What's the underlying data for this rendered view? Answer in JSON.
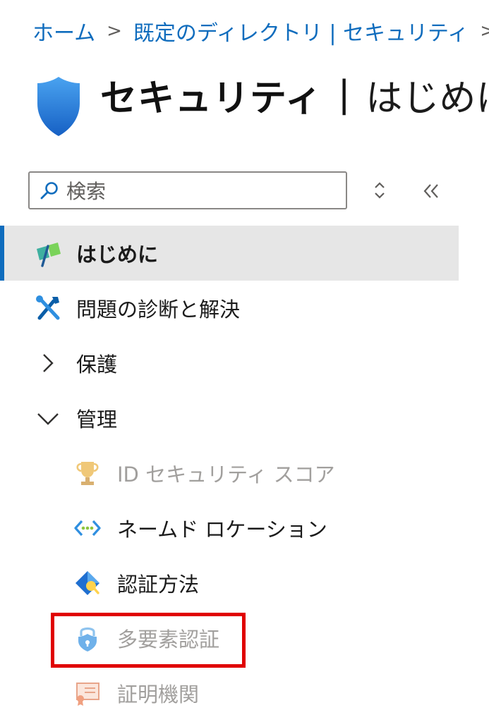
{
  "breadcrumb": {
    "items": [
      "ホーム",
      "既定のディレクトリ | セキュリティ"
    ],
    "separator": ">"
  },
  "header": {
    "title": "セキュリティ",
    "separator": "|",
    "subtitle": "はじめに",
    "icon": "shield-icon"
  },
  "search": {
    "placeholder": "検索",
    "icon": "search-icon"
  },
  "controls": {
    "sort_icon": "up-down-icon",
    "collapse_icon": "double-chevron-left-icon"
  },
  "nav": {
    "items": [
      {
        "label": "はじめに",
        "icon": "getting-started-icon",
        "state": "selected"
      },
      {
        "label": "問題の診断と解決",
        "icon": "diagnose-icon"
      },
      {
        "label": "保護",
        "icon": "chevron-right-icon",
        "state": "collapsed"
      },
      {
        "label": "管理",
        "icon": "chevron-down-icon",
        "state": "expanded"
      },
      {
        "label": "ID セキュリティ スコア",
        "icon": "trophy-icon",
        "state": "disabled"
      },
      {
        "label": "ネームド ロケーション",
        "icon": "network-icon"
      },
      {
        "label": "認証方法",
        "icon": "authentication-methods-icon"
      },
      {
        "label": "多要素認証",
        "icon": "mfa-lock-icon",
        "state": "disabled",
        "highlighted": true
      },
      {
        "label": "証明機関",
        "icon": "certificate-icon",
        "state": "disabled"
      }
    ]
  },
  "colors": {
    "accent": "#0f6cbd",
    "selected_bg": "#e6e6e6",
    "disabled_text": "#a19f9d",
    "highlight": "#e00000"
  }
}
